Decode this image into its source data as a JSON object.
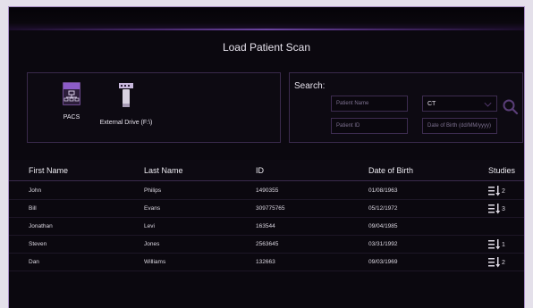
{
  "window": {
    "title": "Load Patient Scan"
  },
  "sources": [
    {
      "label": "PACS",
      "icon": "pacs-network-icon"
    },
    {
      "label": "External Drive (F:\\)",
      "icon": "usb-drive-icon"
    }
  ],
  "search": {
    "label": "Search:",
    "patient_name_placeholder": "Patient Name",
    "patient_id_placeholder": "Patient ID",
    "modality_value": "CT",
    "dob_placeholder": "Date of Birth (dd/MM/yyyy)",
    "button_icon": "search-icon"
  },
  "table": {
    "columns": [
      "First Name",
      "Last Name",
      "ID",
      "Date of Birth",
      "Studies"
    ],
    "rows": [
      {
        "first": "John",
        "last": "Philips",
        "id": "1490355",
        "dob": "01/08/1963",
        "studies": "2"
      },
      {
        "first": "Bill",
        "last": "Evans",
        "id": "309775765",
        "dob": "05/12/1972",
        "studies": "3"
      },
      {
        "first": "Jonathan",
        "last": "Levi",
        "id": "163544",
        "dob": "09/04/1985",
        "studies": ""
      },
      {
        "first": "Steven",
        "last": "Jones",
        "id": "2563645",
        "dob": "03/31/1992",
        "studies": "1"
      },
      {
        "first": "Dan",
        "last": "Williams",
        "id": "132663",
        "dob": "09/03/1969",
        "studies": "2"
      }
    ]
  },
  "colors": {
    "accent": "#8c5cc8",
    "background": "#0b080f",
    "panel_border": "#3a2a4c"
  }
}
